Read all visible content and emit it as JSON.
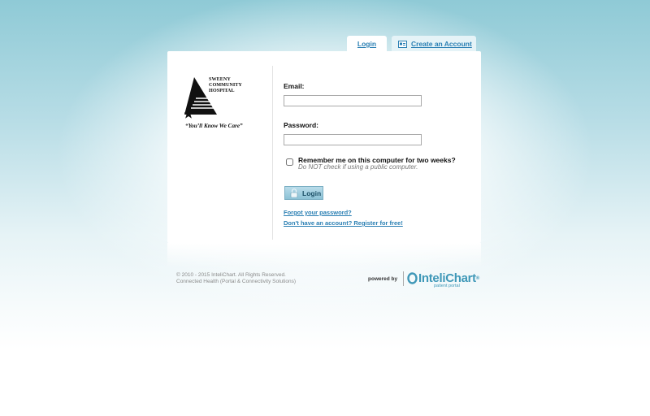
{
  "tabs": {
    "login_label": "Login",
    "create_label": "Create an Account"
  },
  "logo": {
    "name_line1": "SWEENY",
    "name_line2": "COMMUNITY",
    "name_line3": "HOSPITAL",
    "tagline": "“You’ll Know We Care”"
  },
  "form": {
    "email_label": "Email:",
    "email_value": "",
    "password_label": "Password:",
    "password_value": "",
    "remember_label": "Remember me on this computer for two weeks?",
    "remember_note": "Do NOT check if using a public computer.",
    "remember_checked": false,
    "login_button": "Login"
  },
  "links": {
    "forgot": "Forgot your password?",
    "register": "Don't have an account? Register for free!"
  },
  "footer": {
    "line1": "© 2010 - 2015 InteliChart. All Rights Reserved.",
    "line2": "Connected Health (Portal & Connectivity Solutions)"
  },
  "brand": {
    "powered_by": "powered by",
    "name": "InteliChart",
    "registered": "®",
    "sub": "patient portal",
    "color": "#3f98b8"
  },
  "icons": {
    "create_tab": "id-card-icon",
    "login_button": "lock-icon"
  }
}
